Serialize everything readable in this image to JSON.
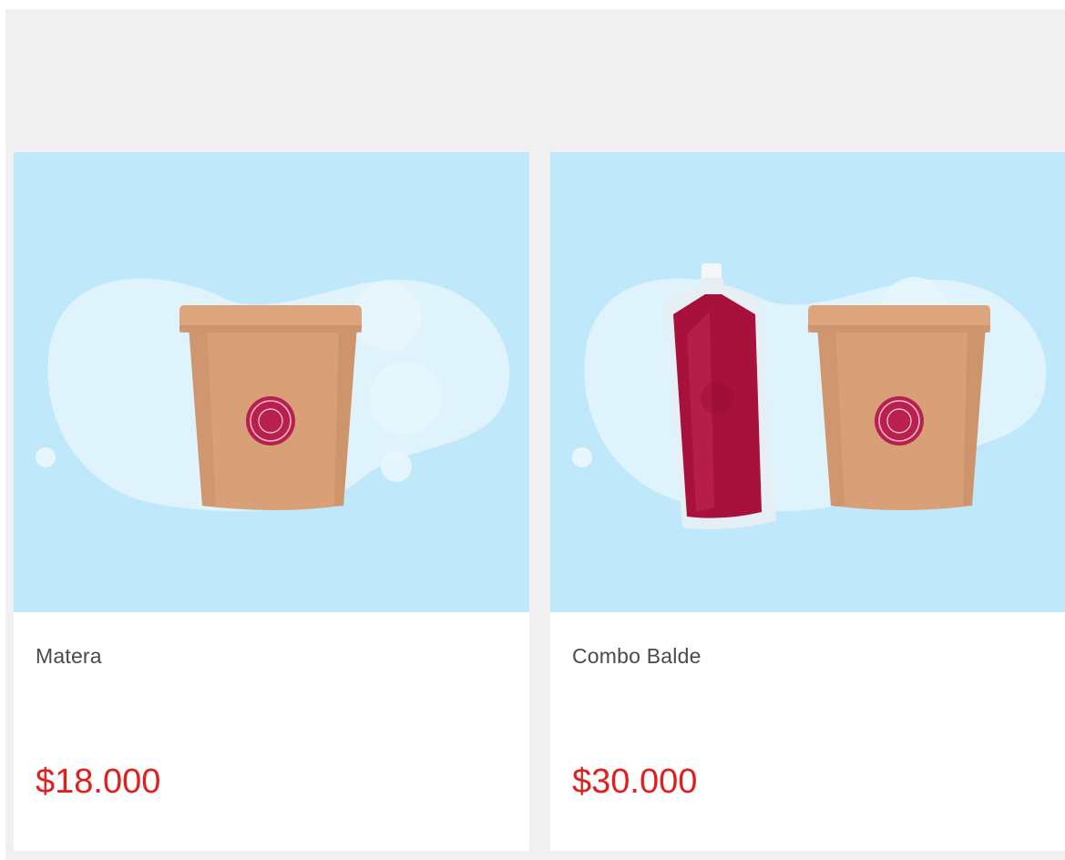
{
  "products": [
    {
      "name": "Matera",
      "price": "$18.000",
      "image_icon": "ice-cream-tub-icon"
    },
    {
      "name": "Combo Balde",
      "price": "$30.000",
      "image_icon": "ice-pouch-and-tub-icon"
    }
  ],
  "colors": {
    "price": "#e0201e",
    "image_bg": "#bfe9fb",
    "page_bg": "#f0f0f0",
    "tub": "#d9a078",
    "drink": "#a8113c"
  }
}
